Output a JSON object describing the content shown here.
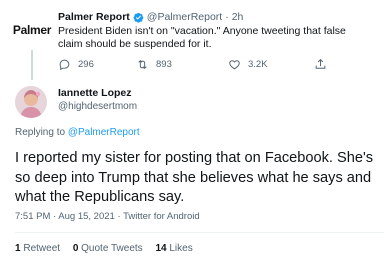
{
  "parent_tweet": {
    "avatar_text": "Palmer",
    "name": "Palmer Report",
    "handle": "@PalmerReport",
    "separator": "·",
    "time": "2h",
    "text": "President Biden isn't on \"vacation.\" Anyone tweeting that false claim should be suspended for it.",
    "actions": {
      "reply_count": "296",
      "retweet_count": "893",
      "like_count": "3.2K"
    }
  },
  "reply_tweet": {
    "name": "Iannette Lopez",
    "handle": "@highdesertmom",
    "replying_prefix": "Replying to",
    "replying_to": "@PalmerReport",
    "text": "I reported my sister for posting that on Facebook. She's so deep into Trump that she believes what he says and what the Republicans say.",
    "timestamp": "7:51 PM · Aug 15, 2021 · Twitter for Android",
    "stats": {
      "retweets_count": "1",
      "retweets_label": "Retweet",
      "quotes_count": "0",
      "quotes_label": "Quote Tweets",
      "likes_count": "14",
      "likes_label": "Likes"
    }
  },
  "colors": {
    "verified": "#1d9bf0",
    "link": "#1d9bf0",
    "secondary_text": "#536471"
  }
}
